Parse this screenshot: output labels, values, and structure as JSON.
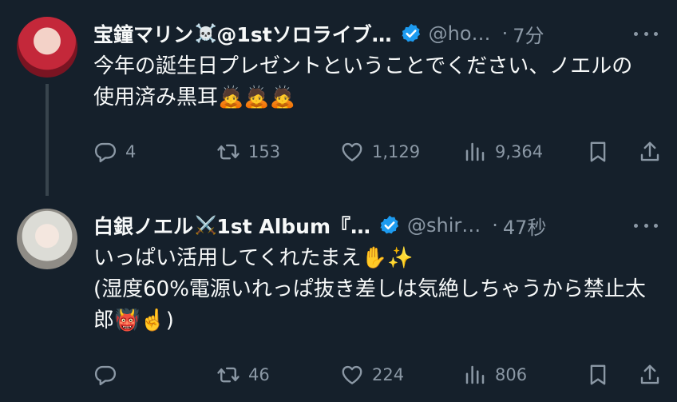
{
  "tweets": [
    {
      "name": "宝鐘マリン",
      "name_emoji": "☠️",
      "name_suffix": "@1stソロライブ…",
      "handle": "@ho…",
      "time": "7分",
      "text": "今年の誕生日プレゼントということでください、ノエルの使用済み黒耳🙇🙇🙇",
      "replies": "4",
      "retweets": "153",
      "likes": "1,129",
      "views": "9,364"
    },
    {
      "name": "白銀ノエル",
      "name_emoji": "⚔️",
      "name_suffix": "1st Album『…",
      "handle": "@shir…",
      "time": "47秒",
      "text": "いっぱい活用してくれたまえ✋✨\n(湿度60%電源いれっぱ抜き差しは気絶しちゃうから禁止太郎👹☝️)",
      "replies": "",
      "retweets": "46",
      "likes": "224",
      "views": "806"
    }
  ],
  "colors": {
    "background": "#15202b",
    "secondary_text": "#8b98a5",
    "verified": "#1d9bf0"
  },
  "icons": [
    "reply-icon",
    "retweet-icon",
    "like-icon",
    "views-icon",
    "bookmark-icon",
    "share-icon",
    "verified-badge-icon",
    "more-icon"
  ]
}
